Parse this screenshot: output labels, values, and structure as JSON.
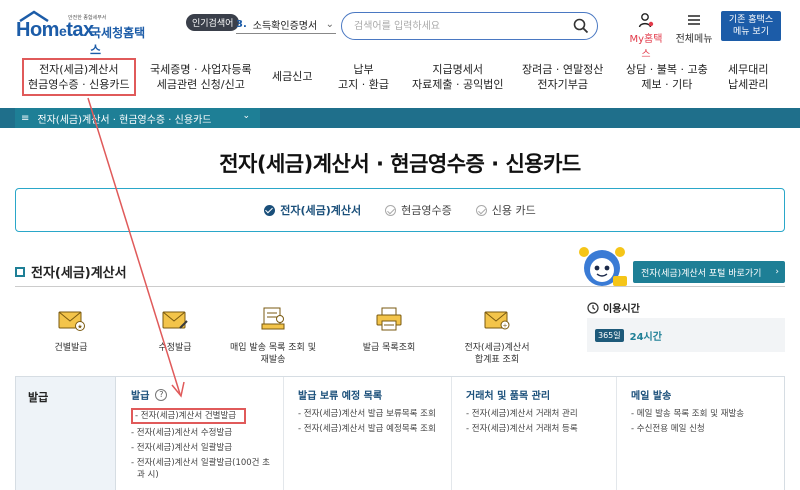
{
  "header": {
    "logo": {
      "brand_main": "Hom",
      "brand_e": "e",
      "brand_tax": "tax",
      "brand_ko": "국세청홈택스",
      "tagline": "안전한 종합세무서"
    },
    "popular_badge": "인기검색어",
    "popular_rank": "3.",
    "popular_term": "소득확인증명서",
    "search_placeholder": "검색어를 입력하세요",
    "my_label": "My홈택스",
    "all_menu_label": "전체메뉴",
    "classic_line1": "기존 홈택스",
    "classic_line2": "메뉴 보기"
  },
  "gnb": [
    {
      "l1": "전자(세금)계산서",
      "l2": "현금영수증 · 신용카드",
      "active": true
    },
    {
      "l1": "국세증명 · 사업자등록",
      "l2": "세금관련 신청/신고"
    },
    {
      "l1": "세금신고",
      "l2": ""
    },
    {
      "l1": "납부",
      "l2": "고지 · 환급"
    },
    {
      "l1": "지급명세서",
      "l2": "자료제출 · 공익법인"
    },
    {
      "l1": "장려금 · 연말정산",
      "l2": "전자기부금"
    },
    {
      "l1": "상담 · 불복 · 고충",
      "l2": "제보 · 기타"
    },
    {
      "l1": "세무대리",
      "l2": "납세관리"
    }
  ],
  "breadcrumb": {
    "icon": "≡",
    "label": "전자(세금)계산서 · 현금영수증 · 신용카드",
    "chevron": "⌄"
  },
  "page_title": "전자(세금)계산서 · 현금영수증 · 신용카드",
  "tabs": [
    {
      "label": "전자(세금)계산서",
      "active": true
    },
    {
      "label": "현금영수증",
      "active": false
    },
    {
      "label": "신용 카드",
      "active": false
    }
  ],
  "section": {
    "title": "전자(세금)계산서",
    "portal_button": "전자(세금)계산서 포털 바로가기",
    "portal_arrow": "›"
  },
  "services": [
    {
      "l1": "건별발급",
      "l2": "",
      "icon": "envelope-star-icon"
    },
    {
      "l1": "수정발급",
      "l2": "",
      "icon": "envelope-edit-icon"
    },
    {
      "l1": "매입 발송 목록 조회 및",
      "l2": "재발송",
      "icon": "document-stamp-icon"
    },
    {
      "l1": "발급 목록조회",
      "l2": "",
      "icon": "printer-icon"
    },
    {
      "l1": "전자(세금)계산서",
      "l2": "합계표 조회",
      "icon": "envelope-search-icon"
    }
  ],
  "hours": {
    "title": "이용시간",
    "days": "365일",
    "value": "24시간"
  },
  "menu": {
    "left_label": "발급",
    "columns": [
      {
        "title": "발급",
        "help": "?",
        "links": [
          "- 전자(세금)계산서 건별발급",
          "- 전자(세금)계산서 수정발급",
          "- 전자(세금)계산서 일괄발급",
          "- 전자(세금)계산서 일괄발급(100건 초과 시)"
        ]
      },
      {
        "title": "발급 보류 예정 목록",
        "links": [
          "- 전자(세금)계산서 발급 보류목록 조회",
          "- 전자(세금)계산서 발급 예정목록 조회"
        ]
      },
      {
        "title": "거래처 및 품목 관리",
        "links": [
          "- 전자(세금)계산서 거래처 관리",
          "- 전자(세금)계산서 거래처 등록"
        ]
      },
      {
        "title": "메일 발송",
        "links": [
          "- 메일 발송 목록 조회 및 재발송",
          "- 수신전용 메일 신청"
        ]
      }
    ]
  },
  "colors": {
    "primary": "#1c5ca8",
    "teal": "#1e7f96",
    "annotation": "#e05a5a"
  }
}
